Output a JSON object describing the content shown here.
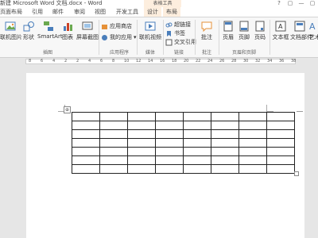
{
  "titlebar": {
    "title": "新建 Microsoft Word 文档.docx - Word",
    "context_group": "表格工具",
    "controls": [
      "?",
      "▢",
      "—",
      "▢"
    ]
  },
  "tabs": [
    {
      "label": "页面布局"
    },
    {
      "label": "引用"
    },
    {
      "label": "邮件"
    },
    {
      "label": "审阅"
    },
    {
      "label": "视图"
    },
    {
      "label": "开发工具"
    },
    {
      "label": "设计"
    },
    {
      "label": "布局"
    }
  ],
  "ribbon": {
    "illustrations": {
      "online_pictures": "联机图片",
      "shapes": "形状",
      "smartart": "SmartArt",
      "chart": "图表",
      "screenshot": "屏幕截图",
      "label": "插图"
    },
    "apps": {
      "store": "应用商店",
      "my_apps": "我的应用",
      "label": "应用程序"
    },
    "media": {
      "online_video": "联机视频",
      "label": "媒体"
    },
    "links": {
      "hyperlink": "超链接",
      "bookmark": "书签",
      "cross_ref": "交叉引用",
      "label": "链接"
    },
    "comments": {
      "comment": "批注",
      "label": "批注"
    },
    "header_footer": {
      "header": "页眉",
      "footer": "页脚",
      "page_number": "页码",
      "label": "页眉和页脚"
    },
    "text": {
      "textbox": "文本框",
      "quick_parts": "文档部件",
      "wordart": "艺术"
    }
  },
  "ruler": {
    "numbers": [
      "8",
      "6",
      "4",
      "2",
      "2",
      "4",
      "6",
      "8",
      "10",
      "12",
      "14",
      "16",
      "18",
      "20",
      "22",
      "24",
      "26",
      "28",
      "30",
      "32",
      "34",
      "36",
      "38"
    ]
  },
  "table": {
    "rows": 7,
    "cols": 8,
    "move_handle": "⊕"
  },
  "colors": {
    "accent": "#2b579a",
    "context_tab": "#fdeede",
    "canvas": "#e6e6e6"
  }
}
